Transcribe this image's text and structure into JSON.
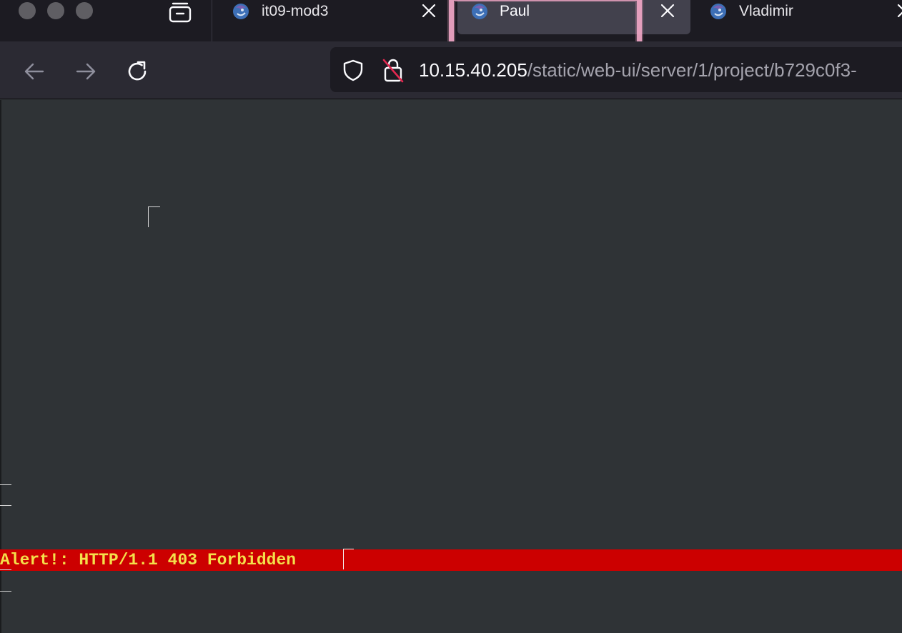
{
  "window": {
    "traffic_lights": [
      "close",
      "minimize",
      "zoom"
    ],
    "traffic_light_color": "#5f5e63"
  },
  "tabs": [
    {
      "title": "it09-mod3",
      "favicon": "app-logo-icon",
      "active": false
    },
    {
      "title": "Paul",
      "favicon": "app-logo-icon",
      "active": true,
      "highlighted": true
    },
    {
      "title": "Vladimir",
      "favicon": "app-logo-icon",
      "active": false
    }
  ],
  "toolbar": {
    "back_icon": "arrow-left-icon",
    "forward_icon": "arrow-right-icon",
    "reload_icon": "reload-icon"
  },
  "urlbar": {
    "host": "10.15.40.205",
    "path": "/static/web-ui/server/1/project/b729c0f3-",
    "tracking_icon": "shield-icon",
    "security_icon": "insecure-lock-icon"
  },
  "page": {
    "alert_text": "Alert!: HTTP/1.1 403 Forbidden",
    "background": "#2f3336",
    "alert_background": "#cc0000",
    "alert_color": "#f4e04a"
  },
  "colors": {
    "tab_strip": "#1c1b22",
    "active_tab": "#42414d",
    "highlight": "#f2a7c7"
  }
}
